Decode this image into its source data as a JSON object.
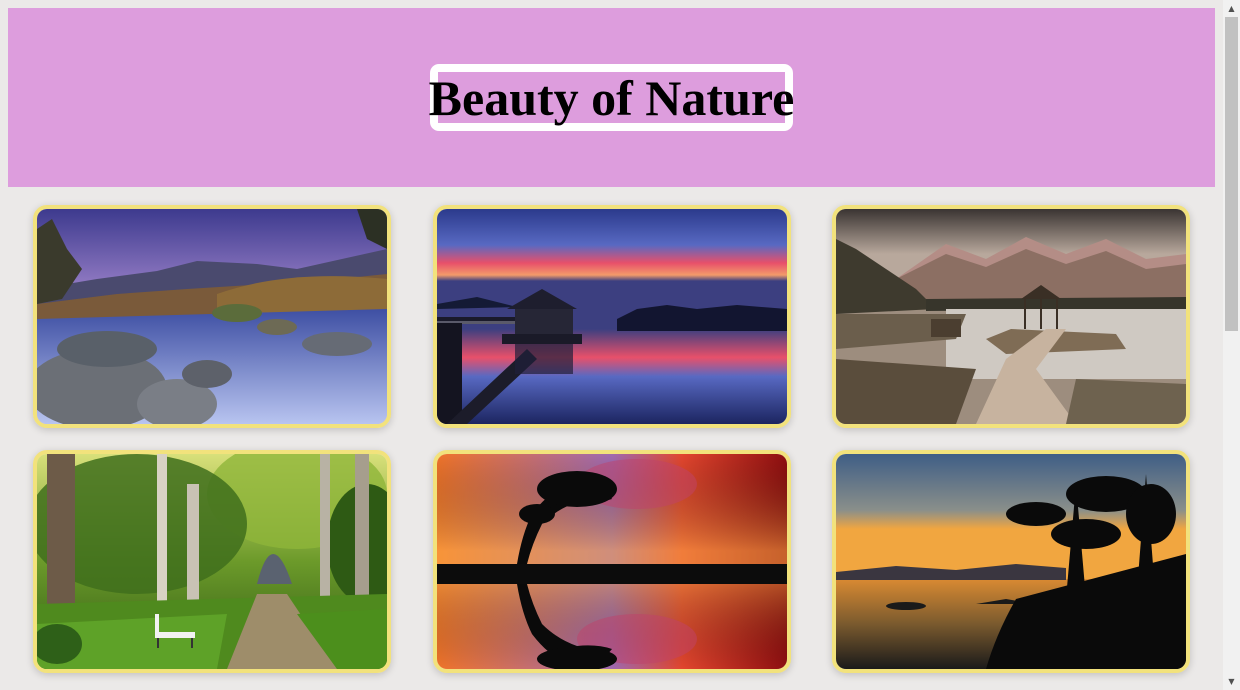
{
  "header": {
    "title": "Beauty of Nature"
  },
  "colors": {
    "header_bg": "#dd9ddd",
    "card_border": "#f2e27c",
    "page_bg": "#ebe9e8"
  },
  "gallery": {
    "images": [
      {
        "subject": "rocky stream at dusk"
      },
      {
        "subject": "pier hut with sunset reflection"
      },
      {
        "subject": "mountain lake with gazebo and path"
      },
      {
        "subject": "green park path with bench"
      },
      {
        "subject": "tree silhouette with fiery sky reflection"
      },
      {
        "subject": "sunset over lake with pine island"
      }
    ]
  },
  "scrollbar": {
    "up_icon": "▲",
    "down_icon": "▼"
  }
}
